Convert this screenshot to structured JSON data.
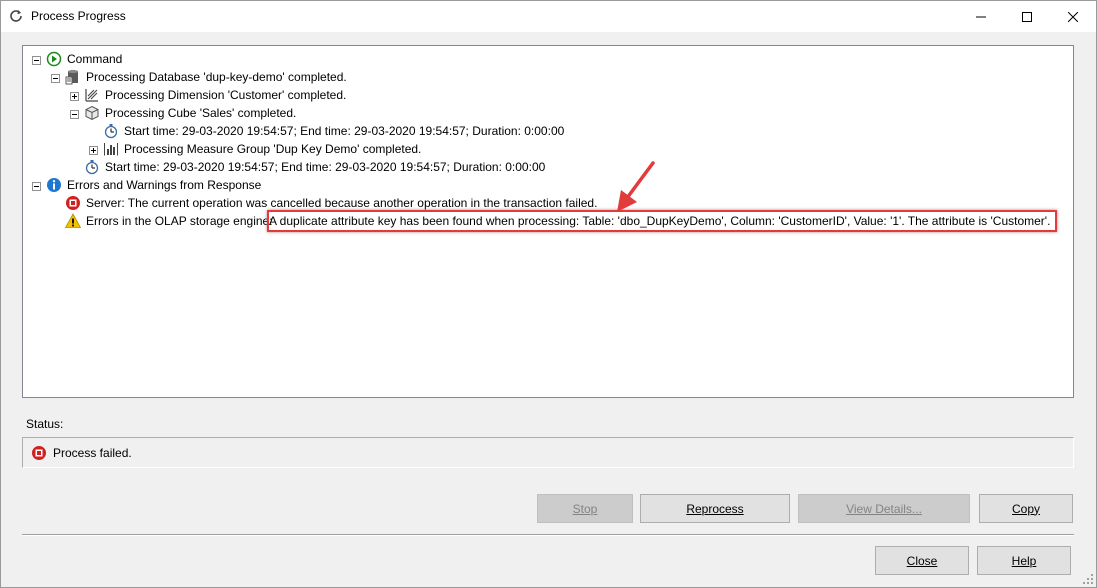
{
  "window": {
    "title": "Process Progress",
    "title_icon": "refresh-icon"
  },
  "log": {
    "command": "Command",
    "database": "Processing Database 'dup-key-demo' completed.",
    "dimension": "Processing Dimension 'Customer' completed.",
    "cube": "Processing Cube 'Sales' completed.",
    "cube_time": "Start time: 29-03-2020 19:54:57; End time: 29-03-2020 19:54:57; Duration: 0:00:00",
    "measure_group": "Processing Measure Group 'Dup Key Demo' completed.",
    "db_time": "Start time: 29-03-2020 19:54:57; End time: 29-03-2020 19:54:57; Duration: 0:00:00",
    "errors_header": "Errors and Warnings from Response",
    "server_error": "Server: The current operation was cancelled because another operation in the transaction failed.",
    "olap_prefix": "Errors in the OLAP storage engine:",
    "olap_message": "A duplicate attribute key has been found when processing: Table: 'dbo_DupKeyDemo', Column: 'CustomerID', Value: '1'. The attribute is 'Customer'."
  },
  "status": {
    "label": "Status:",
    "text": "Process failed."
  },
  "buttons": {
    "stop": "Stop",
    "reprocess": "Reprocess",
    "view_details": "View Details...",
    "copy": "Copy",
    "close": "Close",
    "help": "Help"
  },
  "colors": {
    "highlight": "#e23b3b",
    "error": "#d21f1f",
    "info": "#1e78d2",
    "warning": "#f2c200"
  }
}
